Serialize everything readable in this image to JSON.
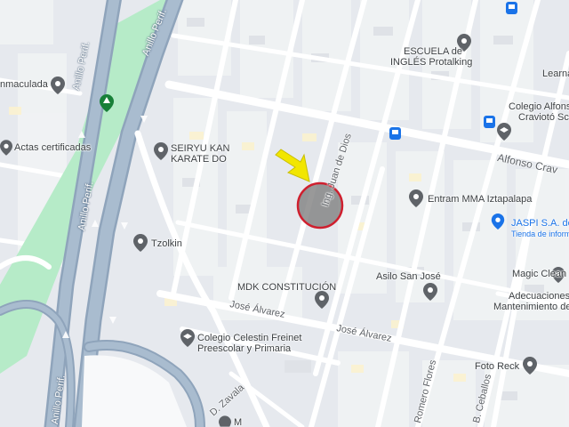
{
  "map": {
    "labels": {
      "inmaculada": "nmaculada",
      "actas": "Actas certificadas",
      "seiryu1": "SEIRYU KAN",
      "seiryu2": "KARATE DO",
      "escuela1": "ESCUELA de",
      "escuela2": "INGLÉS Protalking",
      "colegio_alfonso1": "Colegio Alfonso",
      "colegio_alfonso2": "Craviotó Sc",
      "learna": "Learna",
      "alfonso_crav": "Alfonso Crav",
      "entram": "Entram MMA Iztapalapa",
      "jaspi1": "JASPI S.A. de",
      "jaspi2": "Tienda de informática",
      "tzolkin": "Tzolkin",
      "magic": "Magic Clean",
      "asilo": "Asilo San José",
      "mdk": "MDK CONSTITUCIÓN",
      "adecuaciones1": "Adecuaciones",
      "adecuaciones2": "Mantenimiento de",
      "colegio_celestin1": "Colegio Celestin Freinet",
      "colegio_celestin2": "Preescolar y Primaria",
      "foto_reck": "Foto Reck",
      "marker_partial": "M",
      "juan_de_dios": "Ing. Juan de Dios",
      "jose_alvarez1": "José Álvarez",
      "jose_alvarez2": "José Álvarez",
      "romero_flores": "Romero Flores",
      "b_ceballos": "B. Ceballos",
      "d_zavala": "D. Zavala",
      "anillo1": "Anillo Perif.",
      "anillo2": "Anillo Perif.",
      "anillo3": "Anillo Perif."
    },
    "colors": {
      "land": "#e6e9ee",
      "block": "#f1f3f4",
      "road": "#ffffff",
      "highway": "#8fa4bb",
      "park": "#b6ebc8",
      "pin": "#5f6368",
      "transit": "#1a73e8",
      "arrow": "#f2e600",
      "circle": "#cf1f2e"
    },
    "icons": [
      "place-pin-icon",
      "school-pin-icon",
      "bus-stop-icon",
      "park-tree-icon",
      "location-arrow-icon",
      "highlight-circle"
    ]
  }
}
